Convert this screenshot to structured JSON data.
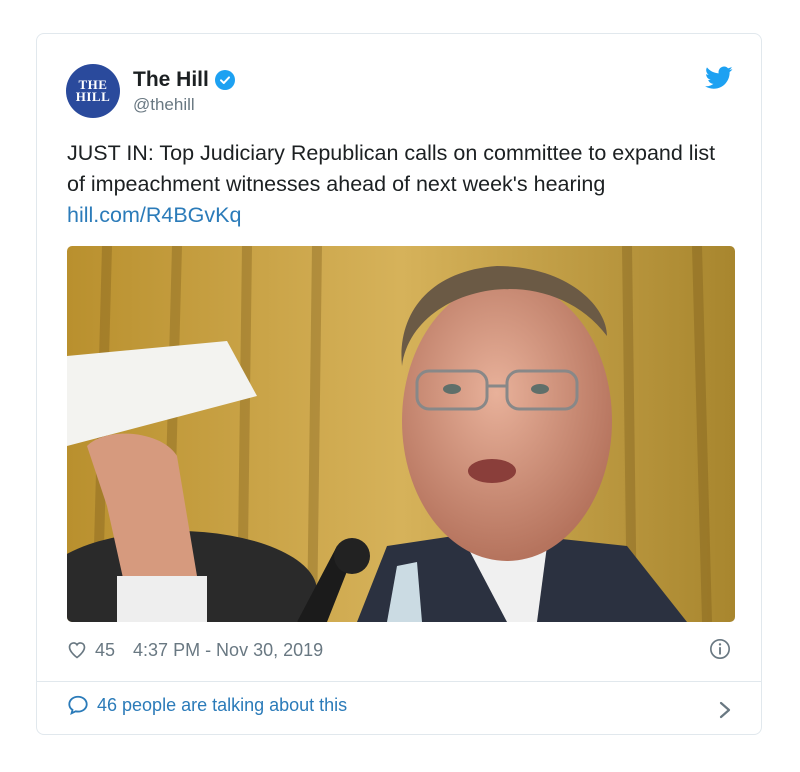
{
  "tweet": {
    "account": {
      "avatar_text_line1": "THE",
      "avatar_text_line2": "HILL",
      "name": "The Hill",
      "handle": "@thehill",
      "verified": true
    },
    "text": "JUST IN: Top Judiciary Republican calls on committee to expand list of impeachment witnesses ahead of next week's hearing",
    "link": "hill.com/R4BGvKq",
    "likes": "45",
    "timestamp": "4:37 PM - Nov 30, 2019",
    "talking": "46 people are talking about this"
  },
  "colors": {
    "brand_blue": "#1da1f2",
    "link": "#2b7bb9",
    "muted": "#697882",
    "avatar_bg": "#2a4a9c"
  },
  "icons": [
    "verified-icon",
    "twitter-bird-icon",
    "heart-icon",
    "info-icon",
    "reply-bubble-icon",
    "chevron-right-icon"
  ]
}
